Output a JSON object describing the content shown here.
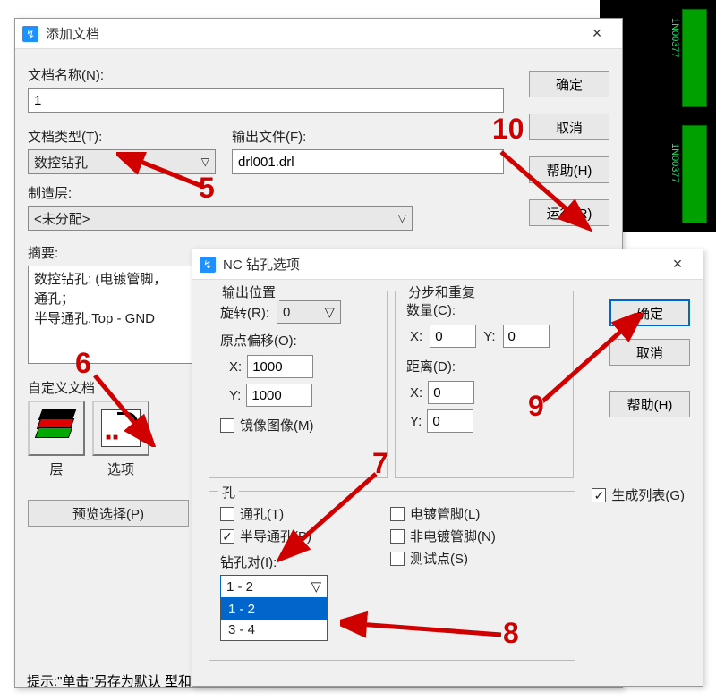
{
  "dialog1": {
    "title": "添加文档",
    "labels": {
      "docName": "文档名称(N):",
      "docType": "文档类型(T):",
      "outputFile": "输出文件(F):",
      "fabLayer": "制造层:",
      "summary": "摘要:",
      "customDocs": "自定义文档",
      "layers": "层",
      "options": "选项",
      "preview": "预览选择(P)"
    },
    "values": {
      "docName": "1",
      "docType": "数控钻孔",
      "outputFile": "drl001.drl",
      "fabLayer": "<未分配>",
      "summaryText": "数控钻孔: (电镀管脚，\n通孔；\n半导通孔:Top - GND"
    },
    "buttons": {
      "ok": "确定",
      "cancel": "取消",
      "help": "帮助(H)",
      "run": "运行(R)"
    }
  },
  "dialog2": {
    "title": "NC 钻孔选项",
    "outputPos": {
      "legend": "输出位置",
      "rotate": "旋转(R):",
      "rotateVal": "0",
      "origin": "原点偏移(O):",
      "x": "X:",
      "y": "Y:",
      "xVal": "1000",
      "yVal": "1000",
      "mirror": "镜像图像(M)"
    },
    "stepRepeat": {
      "legend": "分步和重复",
      "count": "数量(C):",
      "dist": "距离(D):",
      "x": "X:",
      "y": "Y:",
      "cxVal": "0",
      "cyVal": "0",
      "dxVal": "0",
      "dyVal": "0"
    },
    "holes": {
      "legend": "孔",
      "through": "通孔(T)",
      "partial": "半导通孔(P)",
      "drillPair": "钻孔对(I):",
      "drillPairVal": "1 - 2",
      "opt1": "1 - 2",
      "opt2": "3 - 4",
      "plated": "电镀管脚(L)",
      "nonplated": "非电镀管脚(N)",
      "testpoint": "测试点(S)"
    },
    "genList": "生成列表(G)",
    "buttons": {
      "ok": "确定",
      "cancel": "取消",
      "help": "帮助(H)"
    }
  },
  "annotations": {
    "a5": "5",
    "a6": "6",
    "a7": "7",
    "a8": "8",
    "a9": "9",
    "a10": "10"
  },
  "hint": "提示:\"单击\"另存为默认\n        型和输出设备的默",
  "pcb": {
    "t1": "1N00377",
    "t2": "1N00377"
  }
}
